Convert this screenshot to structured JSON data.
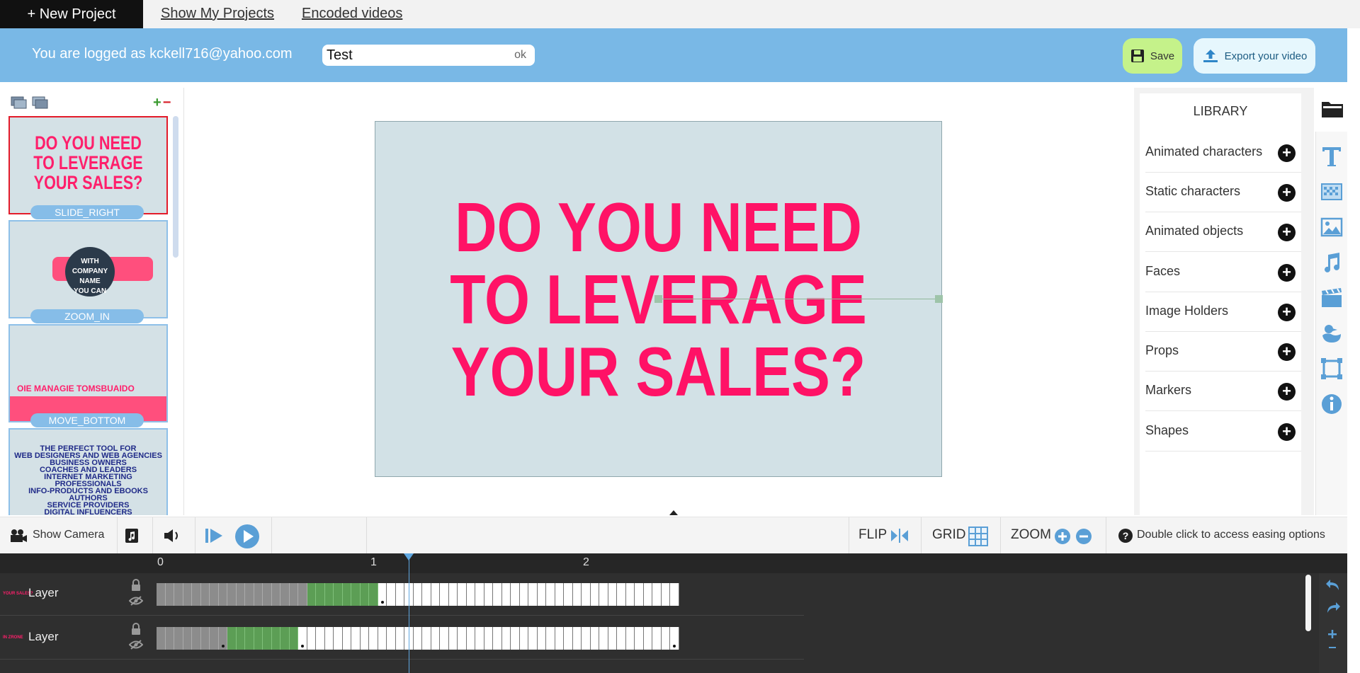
{
  "topbar": {
    "new_project": "+ New Project",
    "show_projects": "Show My Projects",
    "encoded_videos": "Encoded videos"
  },
  "header": {
    "logged_as": "You are logged as kckell716@yahoo.com",
    "project_title_value": "Test",
    "ok_label": "ok",
    "save_label": "Save",
    "export_label": "Export your video"
  },
  "slides": [
    {
      "label": "SLIDE_RIGHT",
      "text": "DO YOU NEED\nTO LEVERAGE\nYOUR SALES?"
    },
    {
      "label": "ZOOM_IN",
      "text": "WITH\nCOMPANY NAME\nYOU CAN"
    },
    {
      "label": "MOVE_BOTTOM",
      "text": "OIE MANAGIE TOMSBUAIDO"
    },
    {
      "label": "",
      "text": "THE PERFECT TOOL FOR\nWEB DESIGNERS AND WEB AGENCIES\nBUSINESS OWNERS\nCOACHES AND LEADERS\nINTERNET MARKETING PROFESSIONALS\nINFO-PRODUCTS AND EBOOKS AUTHORS\nSERVICE PROVIDERS\nDIGITAL INFLUENCERS\nDIGITAL ENTREPRENEURS"
    }
  ],
  "stage": {
    "text": "DO YOU NEED\nTO LEVERAGE\nYOUR SALES?"
  },
  "library": {
    "title": "LIBRARY",
    "items": [
      "Animated characters",
      "Static characters",
      "Animated objects",
      "Faces",
      "Image Holders",
      "Props",
      "Markers",
      "Shapes"
    ]
  },
  "controls": {
    "show_camera": "Show Camera",
    "flip": "FLIP",
    "grid": "GRID",
    "zoom": "ZOOM",
    "help": "Double click to access easing options"
  },
  "timeline": {
    "marks": [
      "0",
      "1",
      "2"
    ],
    "layers": [
      {
        "name": "Layer",
        "thumb": "YOUR SALES?"
      },
      {
        "name": "Layer",
        "thumb": "IN ZRONE"
      }
    ]
  },
  "colors": {
    "accent_blue": "#79b8e6",
    "stage_bg": "#d2e1e6",
    "headline_pink": "#ff1266",
    "save_green": "#c5f28a",
    "frame_green": "#5c9e55"
  }
}
